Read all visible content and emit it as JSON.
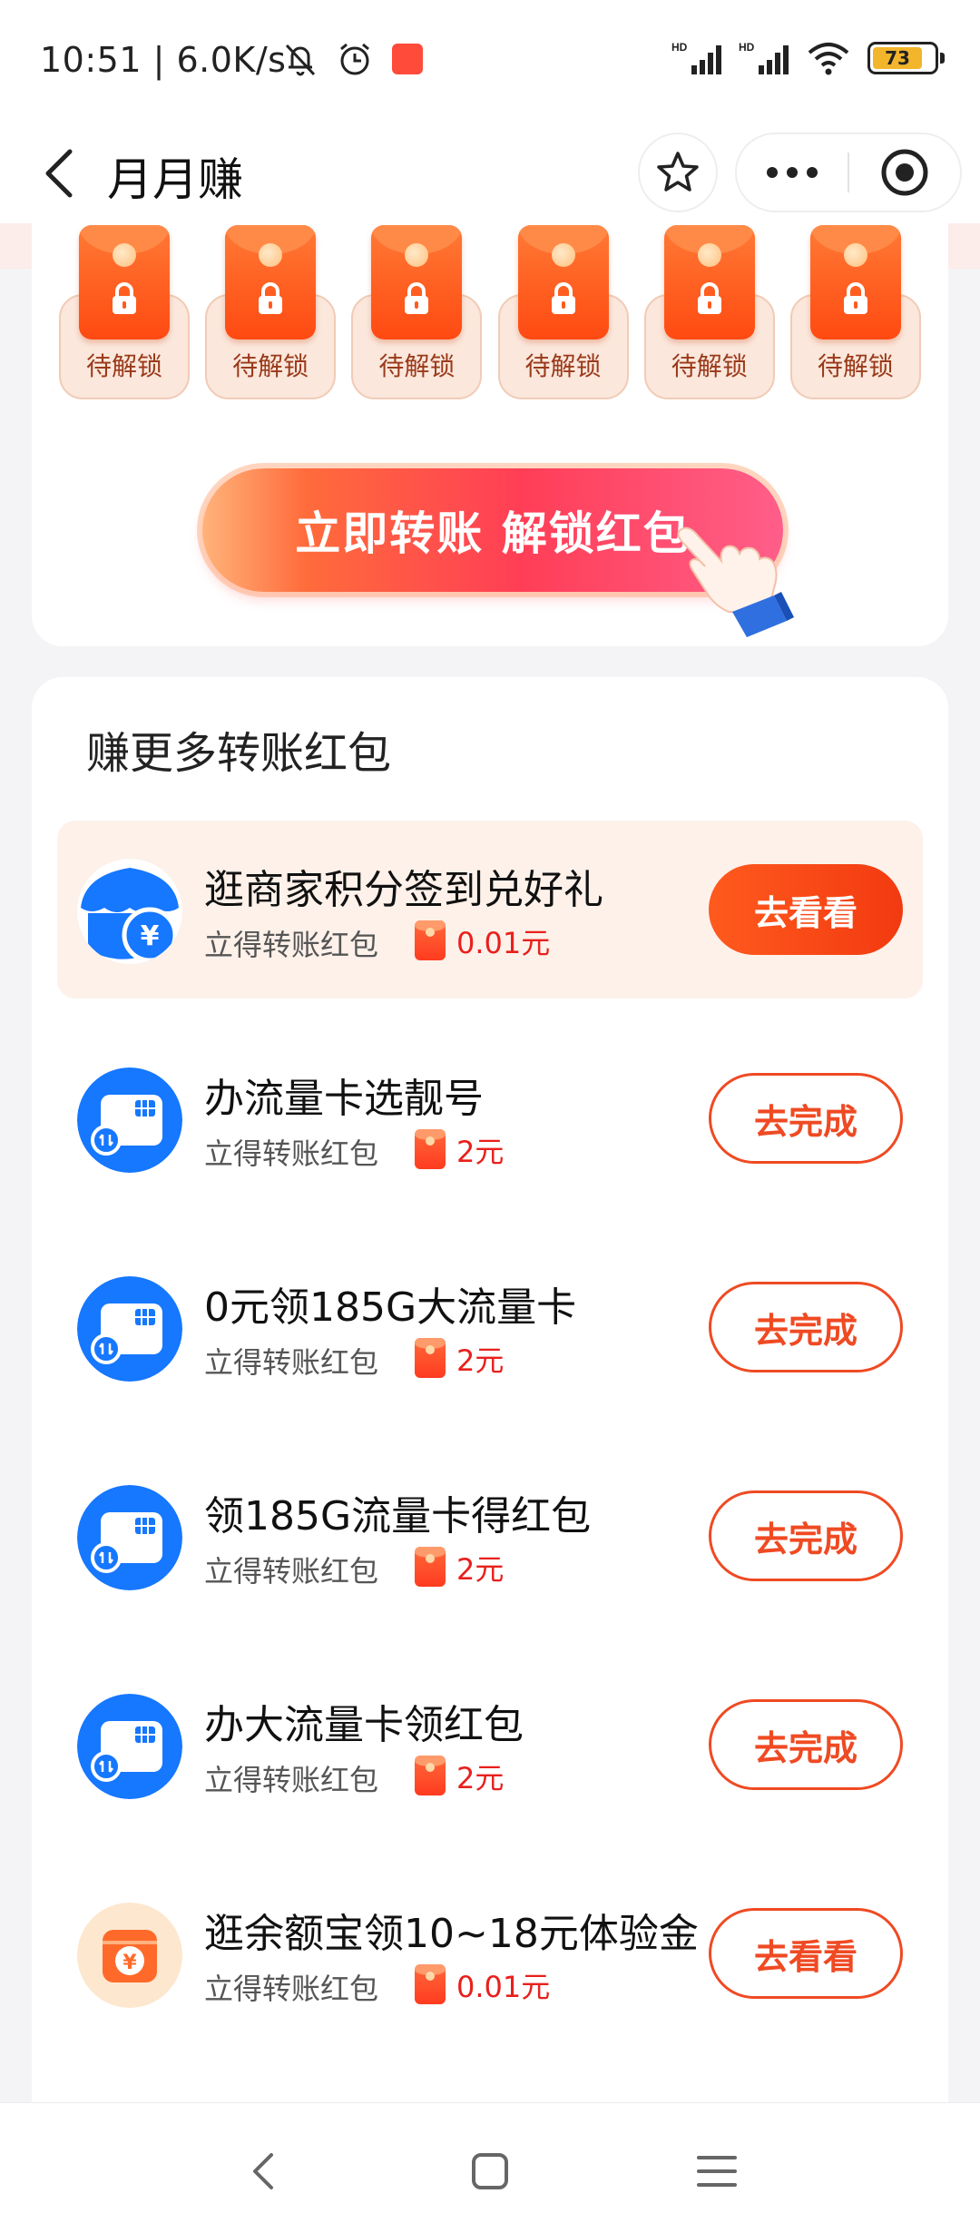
{
  "status_bar": {
    "time": "10:51",
    "speed": "6.0K/s",
    "battery_level": "73",
    "icons": [
      "mute-bell-icon",
      "alarm-icon",
      "app-notification-icon",
      "hd-signal-icon",
      "hd-signal-icon",
      "wifi-icon",
      "battery-icon"
    ]
  },
  "nav": {
    "title": "月月赚",
    "icons": [
      "back-arrow-icon",
      "star-icon",
      "more-icon",
      "close-target-icon"
    ]
  },
  "envelopes": {
    "items": [
      {
        "label": "待解锁"
      },
      {
        "label": "待解锁"
      },
      {
        "label": "待解锁"
      },
      {
        "label": "待解锁"
      },
      {
        "label": "待解锁"
      },
      {
        "label": "待解锁"
      }
    ],
    "unlock_button": "立即转账 解锁红包"
  },
  "section": {
    "title": "赚更多转账红包",
    "tasks": [
      {
        "title": "逛商家积分签到兑好礼",
        "sub": "立得转账红包",
        "reward": "0.01元",
        "button": "去看看",
        "style": "solid",
        "icon": "shop-yuan-icon",
        "highlight": true
      },
      {
        "title": "办流量卡选靓号",
        "sub": "立得转账红包",
        "reward": "2元",
        "button": "去完成",
        "style": "outline",
        "icon": "sim-card-icon",
        "highlight": false
      },
      {
        "title": "0元领185G大流量卡",
        "sub": "立得转账红包",
        "reward": "2元",
        "button": "去完成",
        "style": "outline",
        "icon": "sim-card-icon",
        "highlight": false
      },
      {
        "title": "领185G流量卡得红包",
        "sub": "立得转账红包",
        "reward": "2元",
        "button": "去完成",
        "style": "outline",
        "icon": "sim-card-icon",
        "highlight": false
      },
      {
        "title": "办大流量卡领红包",
        "sub": "立得转账红包",
        "reward": "2元",
        "button": "去完成",
        "style": "outline",
        "icon": "sim-card-icon",
        "highlight": false
      },
      {
        "title": "逛余额宝领10~18元体验金",
        "sub": "立得转账红包",
        "reward": "0.01元",
        "button": "去看看",
        "style": "outline",
        "icon": "yuebao-icon",
        "highlight": false
      }
    ]
  },
  "colors": {
    "accent": "#ef4a23",
    "reward": "#e8201c",
    "sim_blue": "#1677ff",
    "highlight_bg": "#fdf1ea"
  }
}
